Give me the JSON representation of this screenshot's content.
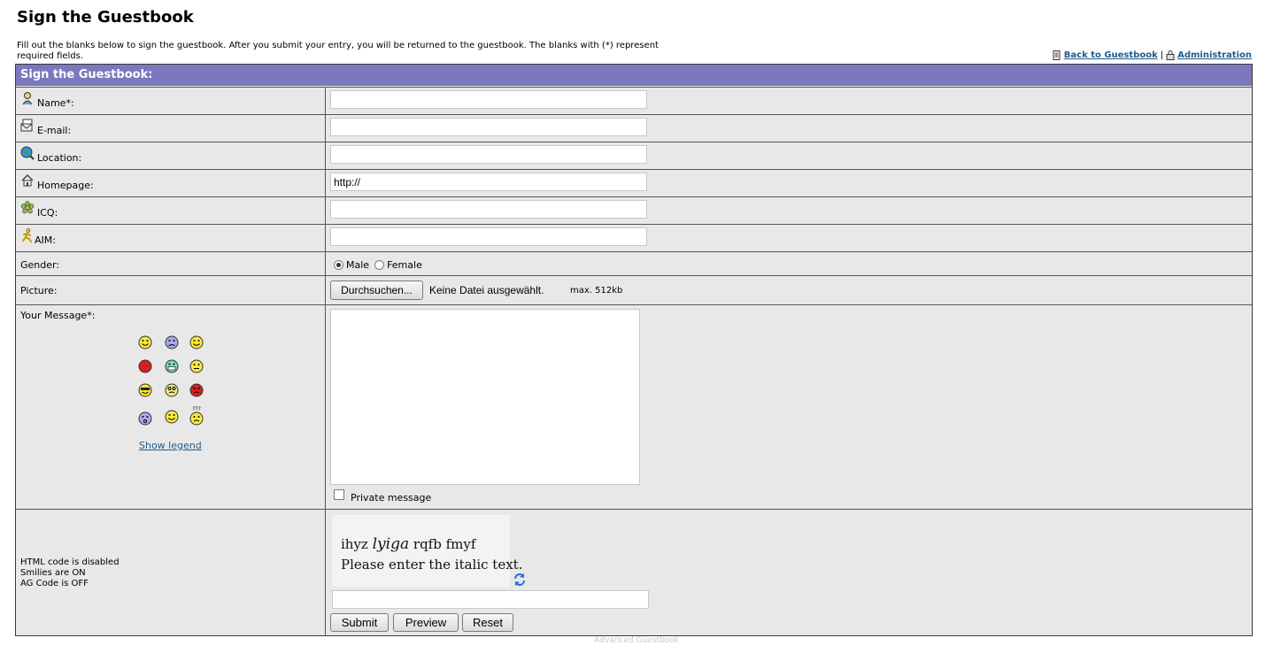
{
  "page": {
    "title": "Sign the Guestbook",
    "intro": "Fill out the blanks below to sign the guestbook. After you submit your entry, you will be returned to the guestbook. The blanks with (*) represent required fields."
  },
  "toplinks": {
    "back": "Back to Guestbook",
    "separator": "|",
    "admin": "Administration"
  },
  "form": {
    "header": "Sign the Guestbook:",
    "name_label": "Name*:",
    "email_label": "E-mail:",
    "location_label": "Location:",
    "homepage_label": "Homepage:",
    "homepage_value": "http://",
    "icq_label": "ICQ:",
    "aim_label": "AIM:",
    "gender_label": "Gender:",
    "gender_male": "Male",
    "gender_female": "Female",
    "picture_label": "Picture:",
    "browse_button": "Durchsuchen...",
    "no_file": "Keine Datei ausgewählt.",
    "max_size": "max. 512kb",
    "message_label": "Your Message*:",
    "show_legend": "Show legend",
    "private_message": "Private message",
    "html_status": "HTML code is disabled",
    "smilies_status": "Smilies are ON",
    "ag_status": "AG Code is OFF",
    "captcha_w1": "ihyz",
    "captcha_w2": "lyiga",
    "captcha_w3": "rqfb",
    "captcha_w4": "fmyf",
    "captcha_prompt": "Please enter the italic text.",
    "submit": "Submit",
    "preview": "Preview",
    "reset": "Reset"
  },
  "footer": "Advanced Guestbook",
  "colors": {
    "header_bg": "#7b78bd",
    "row_bg": "#e8e8e8",
    "link": "#1f5c8c"
  }
}
